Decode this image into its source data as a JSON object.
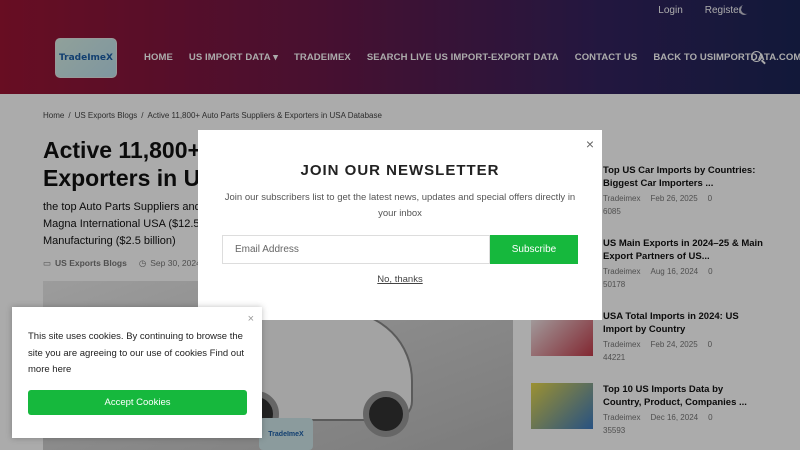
{
  "topbar": {
    "login": "Login",
    "register": "Register"
  },
  "logo": {
    "text": "TradeImeX"
  },
  "nav": [
    "HOME",
    "US IMPORT DATA ▾",
    "TRADEIMEX",
    "SEARCH LIVE US IMPORT-EXPORT DATA",
    "CONTACT US",
    "BACK TO USIMPORTDATA.COM"
  ],
  "breadcrumb": [
    "Home",
    "/",
    "US Exports Blogs",
    "/",
    "Active 11,800+ Auto Parts Suppliers & Exporters in USA Database"
  ],
  "article": {
    "title": "Active 11,800+ Auto Parts Suppliers & Exporters in USA Database",
    "excerpt": "the top Auto Parts Suppliers and Exporters in the USA including BorgWarner ($15.8 billion), Magna International USA ($12.5 billion), Lear Corporation ($4.2 billion) and American Axle & Manufacturing ($2.5 billion)",
    "category": "US Exports Blogs",
    "date": "Sep 30, 2024"
  },
  "sidebar": [
    {
      "title": "Top US Car Imports by Countries: Biggest Car Importers ...",
      "author": "Tradeimex",
      "date": "Feb 26, 2025",
      "comments": "0",
      "views": "6085"
    },
    {
      "title": "US Main Exports in 2024–25 & Main Export Partners of US...",
      "author": "Tradeimex",
      "date": "Aug 16, 2024",
      "comments": "0",
      "views": "50178"
    },
    {
      "title": "USA Total Imports in 2024: US Import by Country",
      "author": "Tradeimex",
      "date": "Feb 24, 2025",
      "comments": "0",
      "views": "44221"
    },
    {
      "title": "Top 10 US Imports Data by Country, Product, Companies ...",
      "author": "Tradeimex",
      "date": "Dec 16, 2024",
      "comments": "0",
      "views": "35593"
    }
  ],
  "newsletter": {
    "title": "JOIN OUR NEWSLETTER",
    "description": "Join our subscribers list to get the latest news, updates and special offers directly in your inbox",
    "email_placeholder": "Email Address",
    "subscribe_label": "Subscribe",
    "no_thanks": "No, thanks"
  },
  "cookie": {
    "text": "This site uses cookies. By continuing to browse the site you are agreeing to our use of cookies Find out more here",
    "accept_label": "Accept Cookies"
  },
  "colors": {
    "accent_green": "#16b83d",
    "header_start": "#9b1434",
    "header_end": "#1b2456"
  }
}
